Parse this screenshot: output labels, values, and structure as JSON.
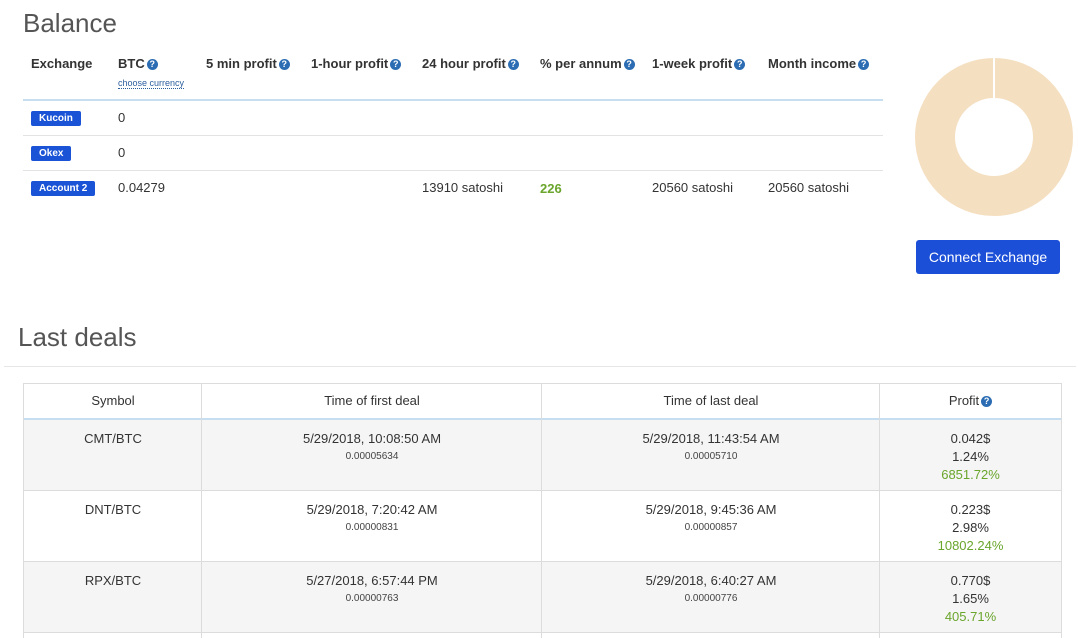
{
  "balance": {
    "title": "Balance",
    "headers": {
      "exchange": "Exchange",
      "btc": "BTC",
      "choose_currency": "choose currency",
      "min5": "5 min profit",
      "hour1": "1-hour profit",
      "hour24": "24 hour profit",
      "per_annum": "% per annum",
      "week1": "1-week profit",
      "month": "Month income"
    },
    "rows": [
      {
        "exchange": "Kucoin",
        "btc": "0",
        "hour24": "",
        "per_annum": "",
        "week1": "",
        "month": ""
      },
      {
        "exchange": "Okex",
        "btc": "0",
        "hour24": "",
        "per_annum": "",
        "week1": "",
        "month": ""
      },
      {
        "exchange": "Account 2",
        "btc": "0.04279",
        "hour24": "13910 satoshi",
        "per_annum": "226",
        "week1": "20560 satoshi",
        "month": "20560 satoshi"
      }
    ],
    "connect_button": "Connect Exchange",
    "donut_color": "#f5dfc1"
  },
  "deals": {
    "title": "Last deals",
    "headers": {
      "symbol": "Symbol",
      "first": "Time of first deal",
      "last": "Time of last deal",
      "profit": "Profit"
    },
    "rows": [
      {
        "symbol": "CMT/BTC",
        "first_time": "5/29/2018, 10:08:50 AM",
        "first_price": "0.00005634",
        "last_time": "5/29/2018, 11:43:54 AM",
        "last_price": "0.00005710",
        "profit_usd": "0.042$",
        "profit_pct": "1.24%",
        "profit_annual": "6851.72%"
      },
      {
        "symbol": "DNT/BTC",
        "first_time": "5/29/2018, 7:20:42 AM",
        "first_price": "0.00000831",
        "last_time": "5/29/2018, 9:45:36 AM",
        "last_price": "0.00000857",
        "profit_usd": "0.223$",
        "profit_pct": "2.98%",
        "profit_annual": "10802.24%"
      },
      {
        "symbol": "RPX/BTC",
        "first_time": "5/27/2018, 6:57:44 PM",
        "first_price": "0.00000763",
        "last_time": "5/29/2018, 6:40:27 AM",
        "last_price": "0.00000776",
        "profit_usd": "0.770$",
        "profit_pct": "1.65%",
        "profit_annual": "405.71%"
      }
    ]
  },
  "icons": {
    "help": "question-circle-icon"
  }
}
